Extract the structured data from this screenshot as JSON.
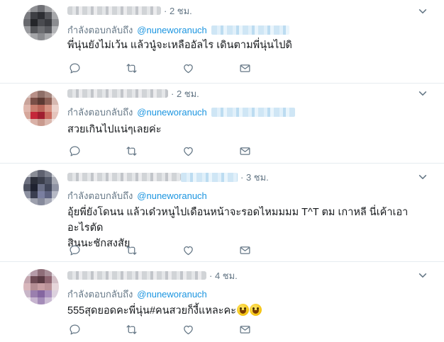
{
  "feed": {
    "tweets": [
      {
        "time": "· 2 ชม.",
        "reply_prefix": "กำลังตอบกลับถึง",
        "mention": "@nuneworanuch",
        "text": "พี่นุ่นยังไม่เว้น แล้วนู๋จะเหลืออัลไร เดินตามพี่นุ่นไปดิ",
        "actions": [
          "reply-icon",
          "retweet-icon",
          "like-icon",
          "message-icon"
        ]
      },
      {
        "time": "· 2 ชม.",
        "reply_prefix": "กำลังตอบกลับถึง",
        "mention": "@nuneworanuch",
        "text": "สวยเกินไปแน่ๆเลยค่ะ",
        "actions": [
          "reply-icon",
          "retweet-icon",
          "like-icon",
          "message-icon"
        ]
      },
      {
        "time": "· 3 ชม.",
        "reply_prefix": "กำลังตอบกลับถึง",
        "mention": "@nuneworanuch",
        "text_line1": "อุ้ยพี่ยังโดนน แล้วเด๋วหนูไปเดือนหน้าจะรอดไหมมมม T^T ตม เกาหลี นี่เค้าเอาอะไรตัด",
        "text_line2": "สินนะชักสงสัย",
        "actions": [
          "reply-icon",
          "retweet-icon",
          "like-icon",
          "message-icon"
        ]
      },
      {
        "time": "· 4 ชม.",
        "reply_prefix": "กำลังตอบกลับถึง",
        "mention": "@nuneworanuch",
        "text": "555สุดยอดคะพี่นุ่น#คนสวยก็งี้แหละคะ",
        "emoji": "grinning-face-emoji",
        "actions": [
          "reply-icon",
          "retweet-icon",
          "like-icon",
          "message-icon"
        ]
      }
    ]
  },
  "colors": {
    "text": "#14171a",
    "secondary": "#657786",
    "link": "#1b95e0",
    "divider": "#e6ecf0"
  }
}
